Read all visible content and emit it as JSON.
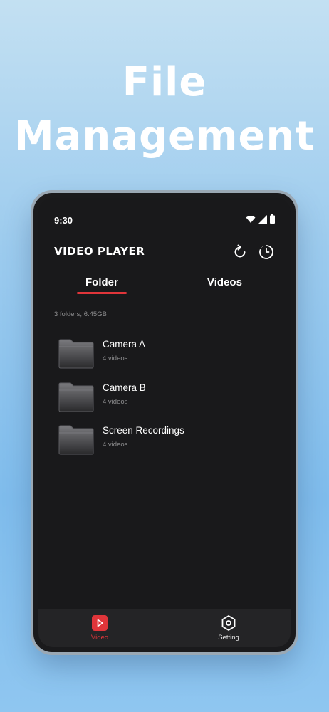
{
  "promo": {
    "line1": "File",
    "line2": "Management"
  },
  "status_bar": {
    "time": "9:30",
    "icons": [
      "wifi-icon",
      "cellular-signal-icon",
      "battery-icon"
    ]
  },
  "app_bar": {
    "title": "VIDEO PLAYER",
    "actions": [
      "refresh-icon",
      "history-clock-icon"
    ]
  },
  "tabs": [
    {
      "label": "Folder",
      "selected": true
    },
    {
      "label": "Videos",
      "selected": false
    }
  ],
  "summary": "3 folders, 6.45GB",
  "folders": [
    {
      "name": "Camera A",
      "count": "4 videos"
    },
    {
      "name": "Camera B",
      "count": "4 videos"
    },
    {
      "name": "Screen Recordings",
      "count": "4 videos"
    }
  ],
  "bottom_nav": [
    {
      "label": "Video",
      "icon": "video-play-icon",
      "active": true
    },
    {
      "label": "Setting",
      "icon": "settings-hexagon-icon",
      "active": false
    }
  ],
  "colors": {
    "accent": "#e0353a",
    "surface": "#19191b",
    "text_primary": "#ffffff",
    "text_secondary": "#8c8c8e"
  }
}
